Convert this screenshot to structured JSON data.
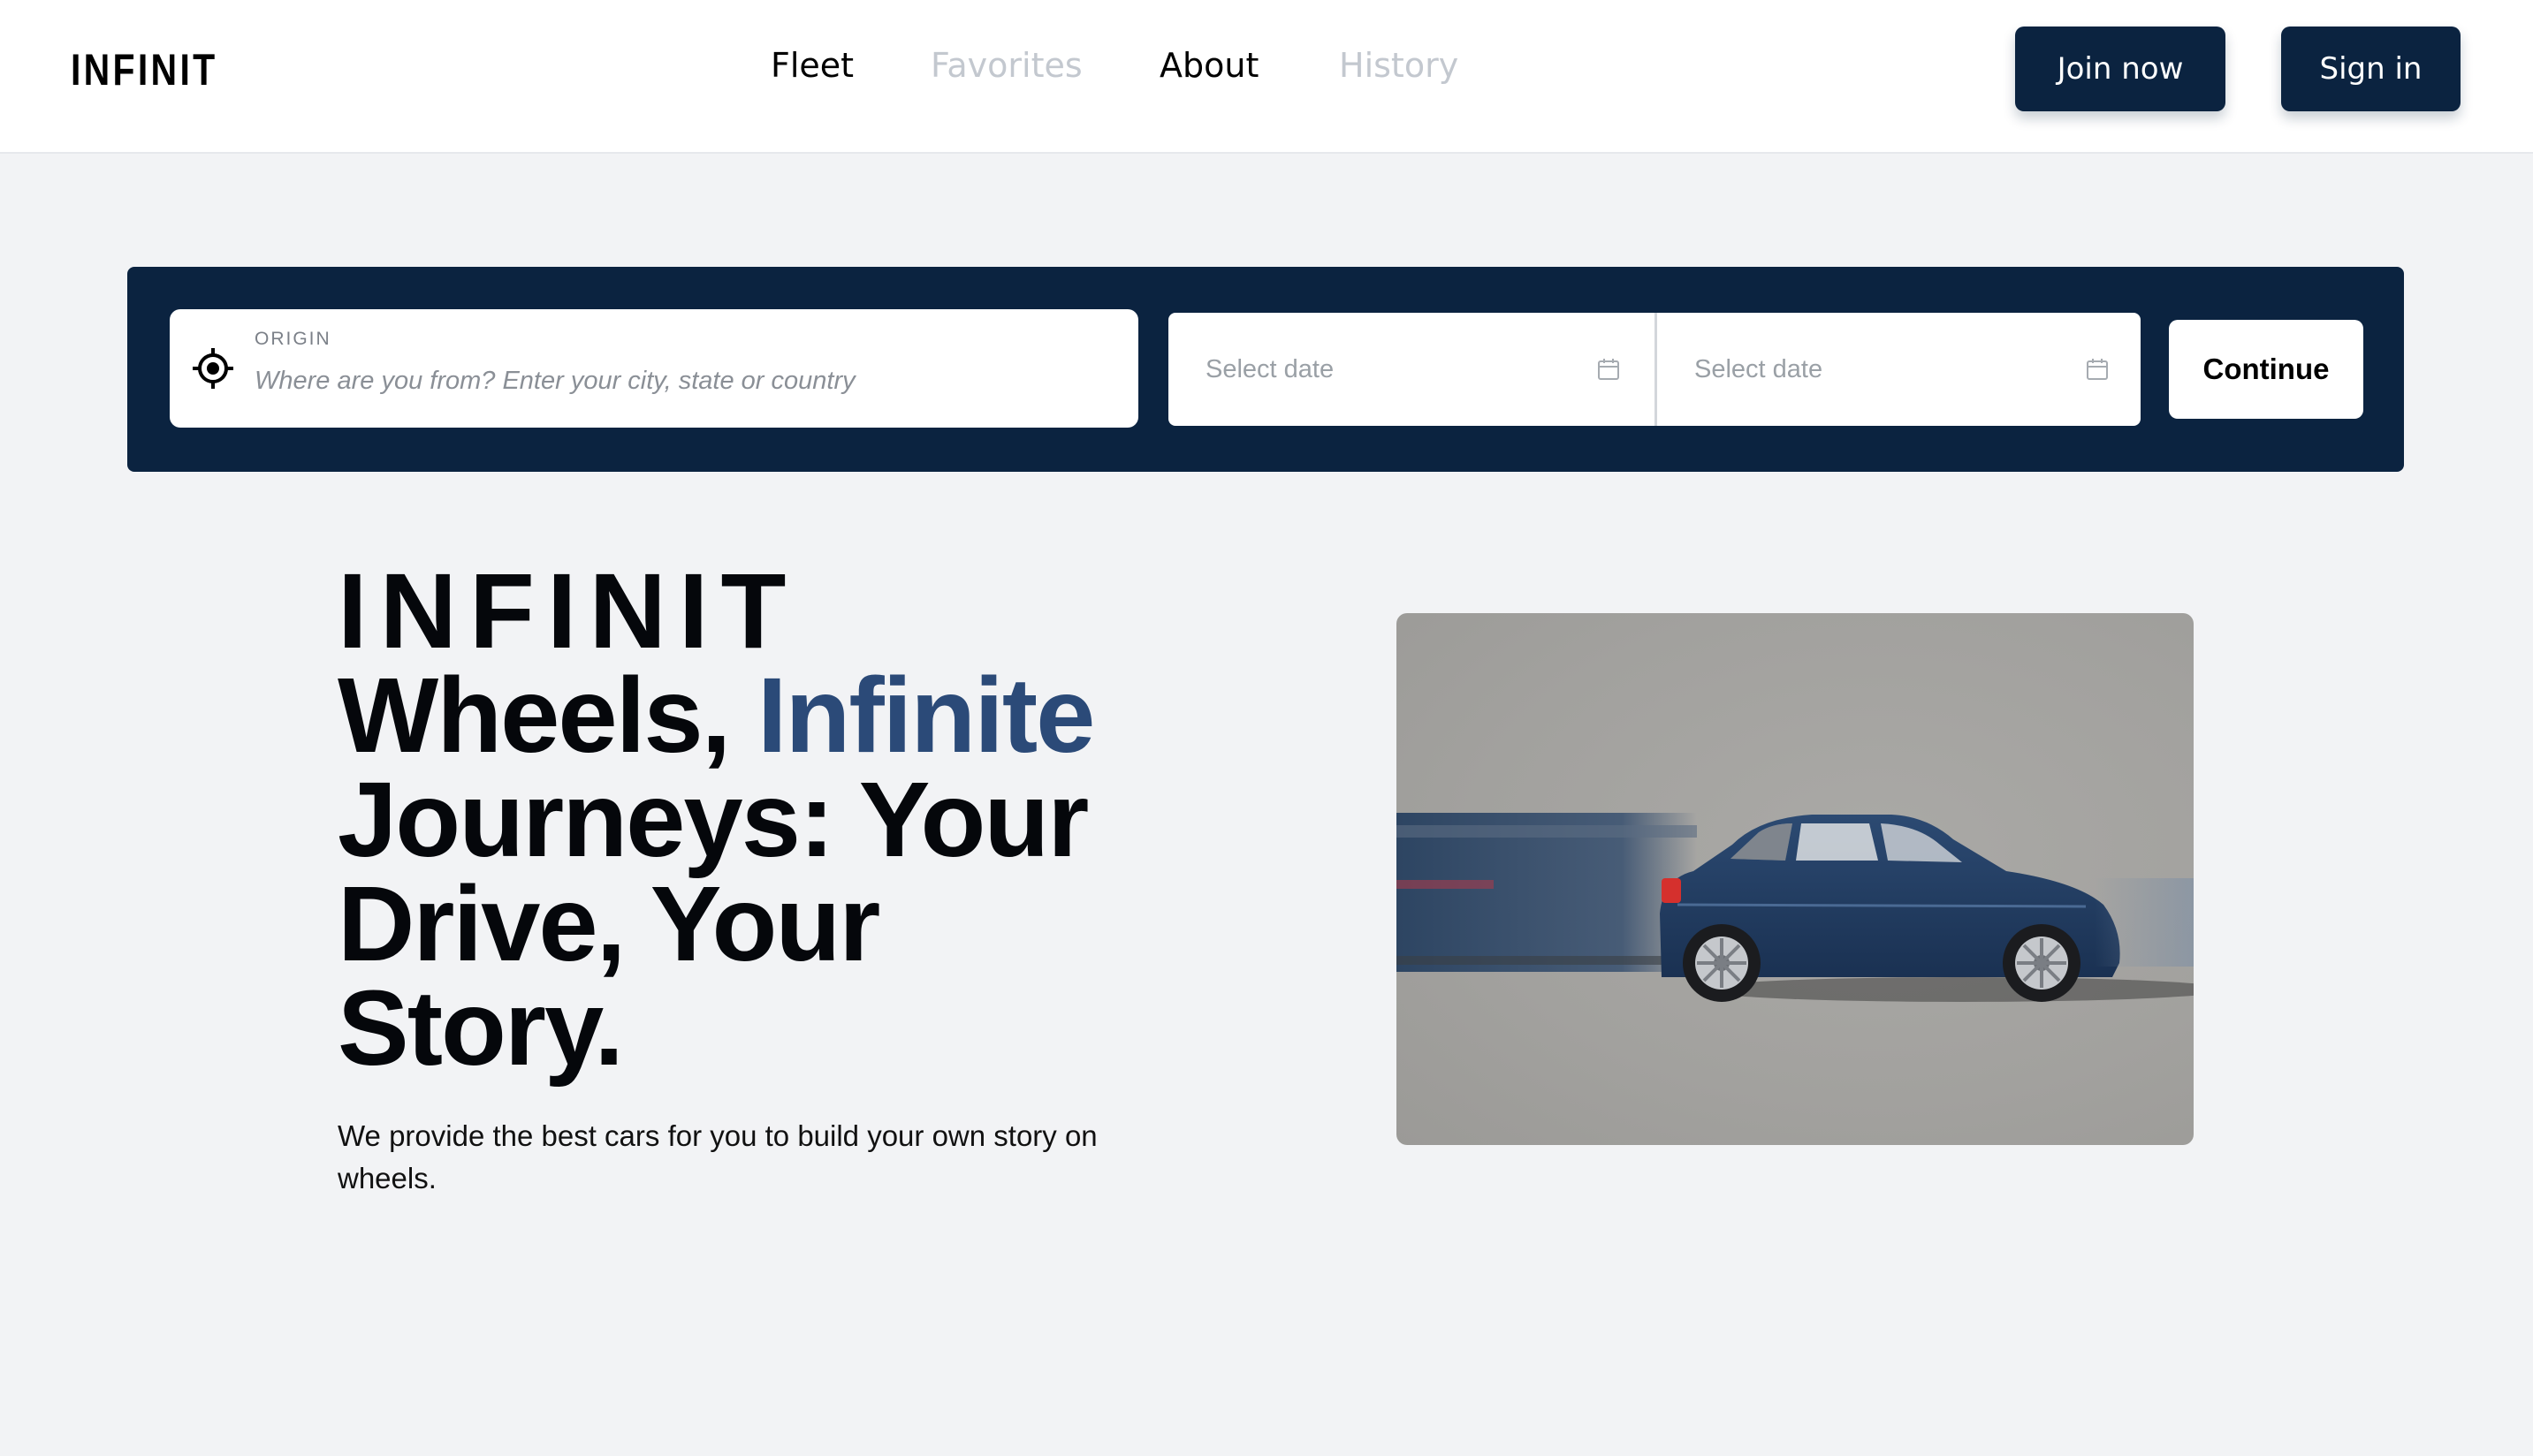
{
  "header": {
    "logo": "INFINIT",
    "nav": [
      {
        "label": "Fleet",
        "state": "active"
      },
      {
        "label": "Favorites",
        "state": "muted"
      },
      {
        "label": "About",
        "state": "active"
      },
      {
        "label": "History",
        "state": "muted"
      }
    ],
    "join_label": "Join now",
    "signin_label": "Sign in"
  },
  "search": {
    "origin_label": "ORIGIN",
    "origin_placeholder": "Where are you from? Enter your city, state or country",
    "date_start_placeholder": "Select date",
    "date_end_placeholder": "Select date",
    "continue_label": "Continue"
  },
  "hero": {
    "brand": "INFINIT",
    "line1_part1": "Wheels, ",
    "line1_accent": "Infinite",
    "line2": "Journeys: Your",
    "line3": "Drive, Your",
    "line4": "Story.",
    "subtitle": "We provide the best cars for you to build your own story on wheels."
  },
  "colors": {
    "navy": "#0b2340",
    "accent_blue": "#2b4a78",
    "muted_nav": "#c3c8cf",
    "page_bg": "#f2f3f5"
  }
}
